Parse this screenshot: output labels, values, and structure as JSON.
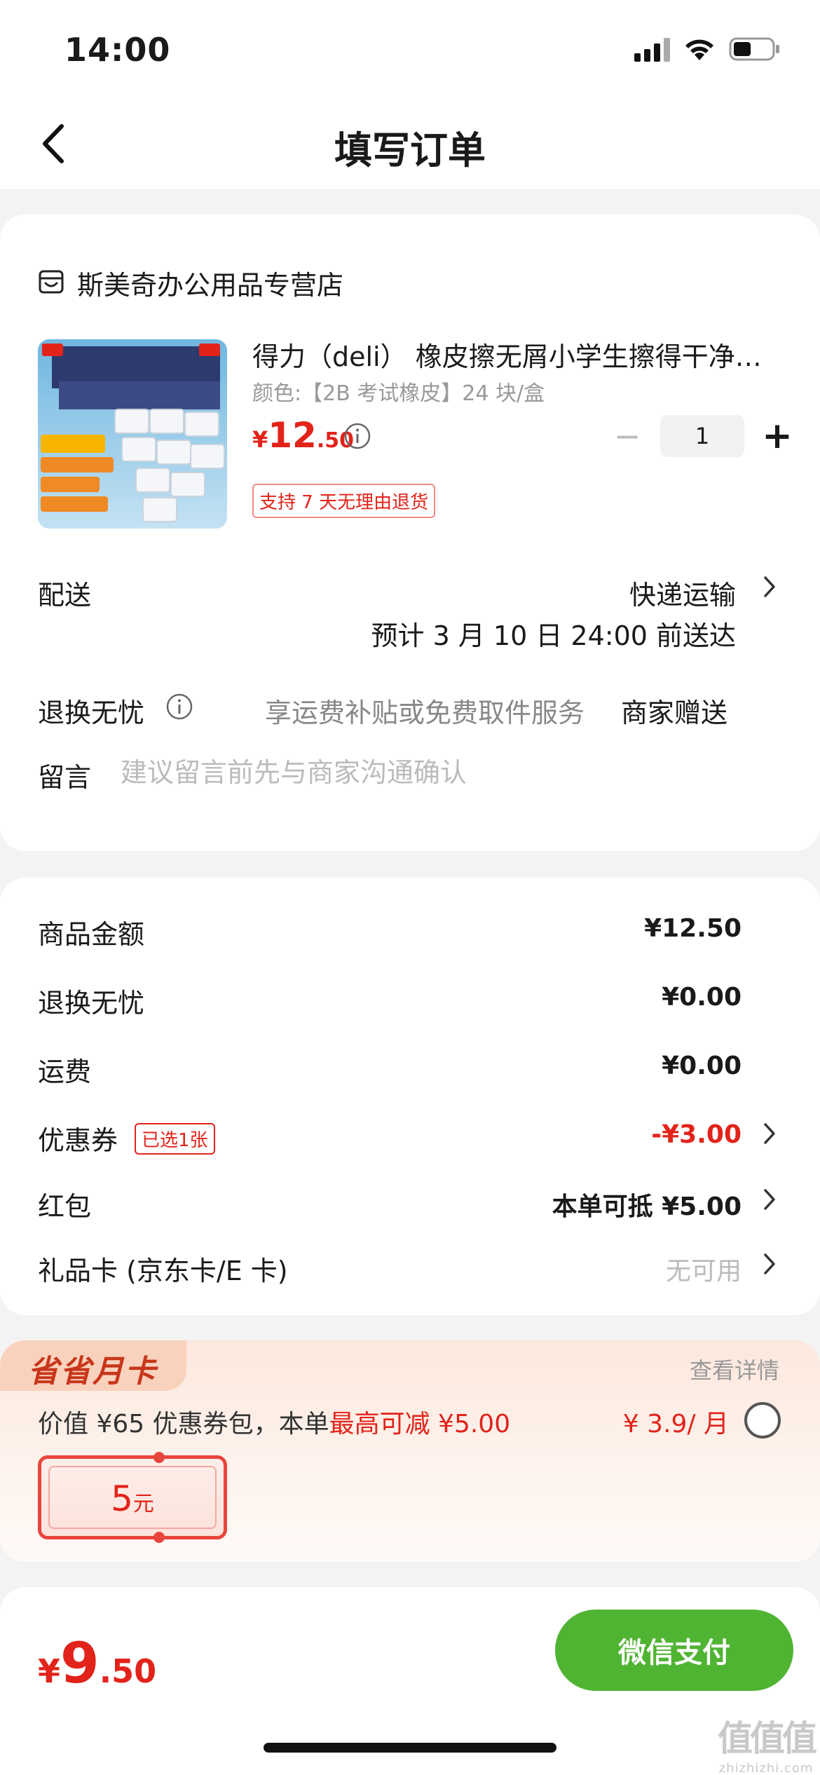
{
  "status_bar": {
    "time": "14:00"
  },
  "nav": {
    "title": "填写订单"
  },
  "shop": {
    "name": "斯美奇办公用品专营店"
  },
  "product": {
    "title": "得力（deli） 橡皮擦无屑小学生擦得干净不留痕美术素描考试橡皮",
    "spec": "颜色:【2B 考试橡皮】24 块/盒",
    "price_currency": "¥",
    "price_int": "12",
    "price_dec": ".50",
    "quantity": "1",
    "qty_minus": "−",
    "qty_plus": "+",
    "return_badge": "支持 7 天无理由退货",
    "image_texts": {
      "top_left": "deli",
      "label": "24块2B橡皮擦",
      "features": [
        "擦拭不易伤纸",
        "质地柔软",
        "少屑不易留痕"
      ]
    }
  },
  "delivery": {
    "label": "配送",
    "method": "快递运输",
    "eta": "预计 3 月 10 日 24:00 前送达"
  },
  "service": {
    "label": "退换无忧",
    "desc": "享运费补贴或免费取件服务",
    "gift": "商家赠送"
  },
  "note": {
    "label": "留言",
    "placeholder": "建议留言前先与商家沟通确认"
  },
  "summary": {
    "goods_label": "商品金额",
    "goods_value": "¥12.50",
    "service_label": "退换无忧",
    "service_value": "¥0.00",
    "shipping_label": "运费",
    "shipping_value": "¥0.00",
    "coupon_label": "优惠券",
    "coupon_badge": "已选1张",
    "coupon_value": "-¥3.00",
    "redpack_label": "红包",
    "redpack_value": "本单可抵 ¥5.00",
    "giftcard_label": "礼品卡 (京东卡/E 卡)",
    "giftcard_value": "无可用"
  },
  "promo": {
    "tag": "省省月卡",
    "detail_link": "查看详情",
    "desc_prefix": "价值 ¥65 优惠券包，本单",
    "desc_highlight": "最高可减 ¥5.00",
    "price": "¥ 3.9/ 月",
    "voucher_amount": "5",
    "voucher_unit": "元"
  },
  "footer": {
    "total_currency": "¥",
    "total_int": "9",
    "total_dec": ".50",
    "pay_label": "微信支付"
  },
  "watermark": {
    "logo": "值值值",
    "site": "zhizhizhi.com"
  },
  "colors": {
    "accent_red": "#e2231a",
    "pay_green": "#50b433",
    "page_bg": "#f3f3f3"
  },
  "icons": [
    "back-arrow-icon",
    "shop-icon",
    "info-icon",
    "chevron-right-icon",
    "signal-icon",
    "wifi-icon",
    "battery-icon"
  ]
}
